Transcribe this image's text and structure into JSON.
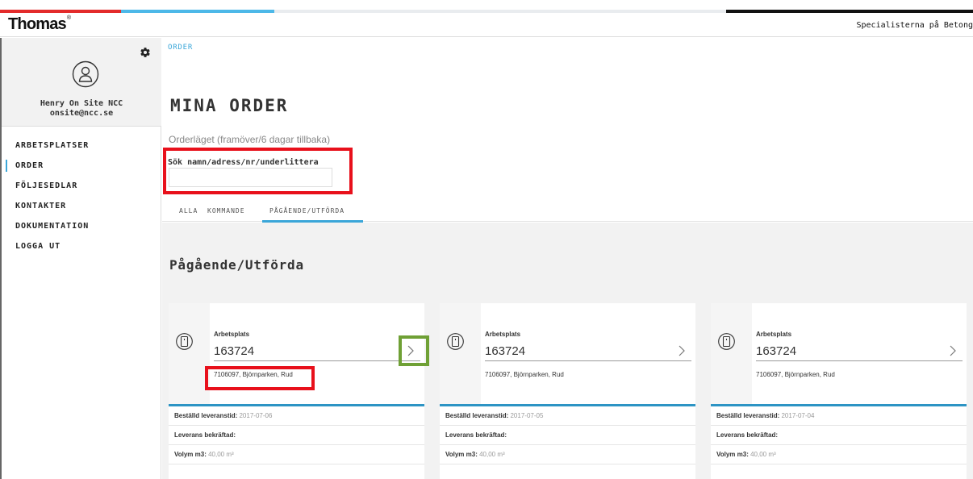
{
  "header": {
    "logo": "Thomas",
    "logo_mark": "®",
    "company": "Specialisterna på Betong"
  },
  "sidebar": {
    "user_name": "Henry On Site NCC",
    "user_email": "onsite@ncc.se",
    "items": [
      {
        "label": "ARBETSPLATSER"
      },
      {
        "label": "ORDER"
      },
      {
        "label": "FÖLJESEDLAR"
      },
      {
        "label": "KONTAKTER"
      },
      {
        "label": "DOKUMENTATION"
      },
      {
        "label": "LOGGA UT"
      }
    ]
  },
  "main": {
    "breadcrumb": "ORDER",
    "title": "MINA ORDER",
    "subtitle": "Orderläget (framöver/6 dagar tillbaka)",
    "search_label": "Sök namn/adress/nr/underlittera",
    "search_value": "",
    "tabs": [
      {
        "label": "ALLA"
      },
      {
        "label": "KOMMANDE"
      },
      {
        "label": "PÅGÅENDE/UTFÖRDA"
      }
    ],
    "section_title": "Pågående/Utförda"
  },
  "cards": [
    {
      "label": "Arbetsplats",
      "number": "163724",
      "address": "7106097, Björnparken, Rud",
      "ordered_label": "Beställd leveranstid:",
      "ordered_value": "2017-07-06",
      "confirmed_label": "Leverans bekräftad:",
      "volume_label": "Volym m3:",
      "volume_value": "40,00 m³"
    },
    {
      "label": "Arbetsplats",
      "number": "163724",
      "address": "7106097, Björnparken, Rud",
      "ordered_label": "Beställd leveranstid:",
      "ordered_value": "2017-07-05",
      "confirmed_label": "Leverans bekräftad:",
      "volume_label": "Volym m3:",
      "volume_value": "40,00 m³"
    },
    {
      "label": "Arbetsplats",
      "number": "163724",
      "address": "7106097, Björnparken, Rud",
      "ordered_label": "Beställd leveranstid:",
      "ordered_value": "2017-07-04",
      "confirmed_label": "Leverans bekräftad:",
      "volume_label": "Volym m3:",
      "volume_value": "40,00 m³"
    }
  ],
  "colors": {
    "accent_blue": "#3aa6d9",
    "highlight_red": "#e8101b",
    "highlight_green": "#6fa035"
  }
}
